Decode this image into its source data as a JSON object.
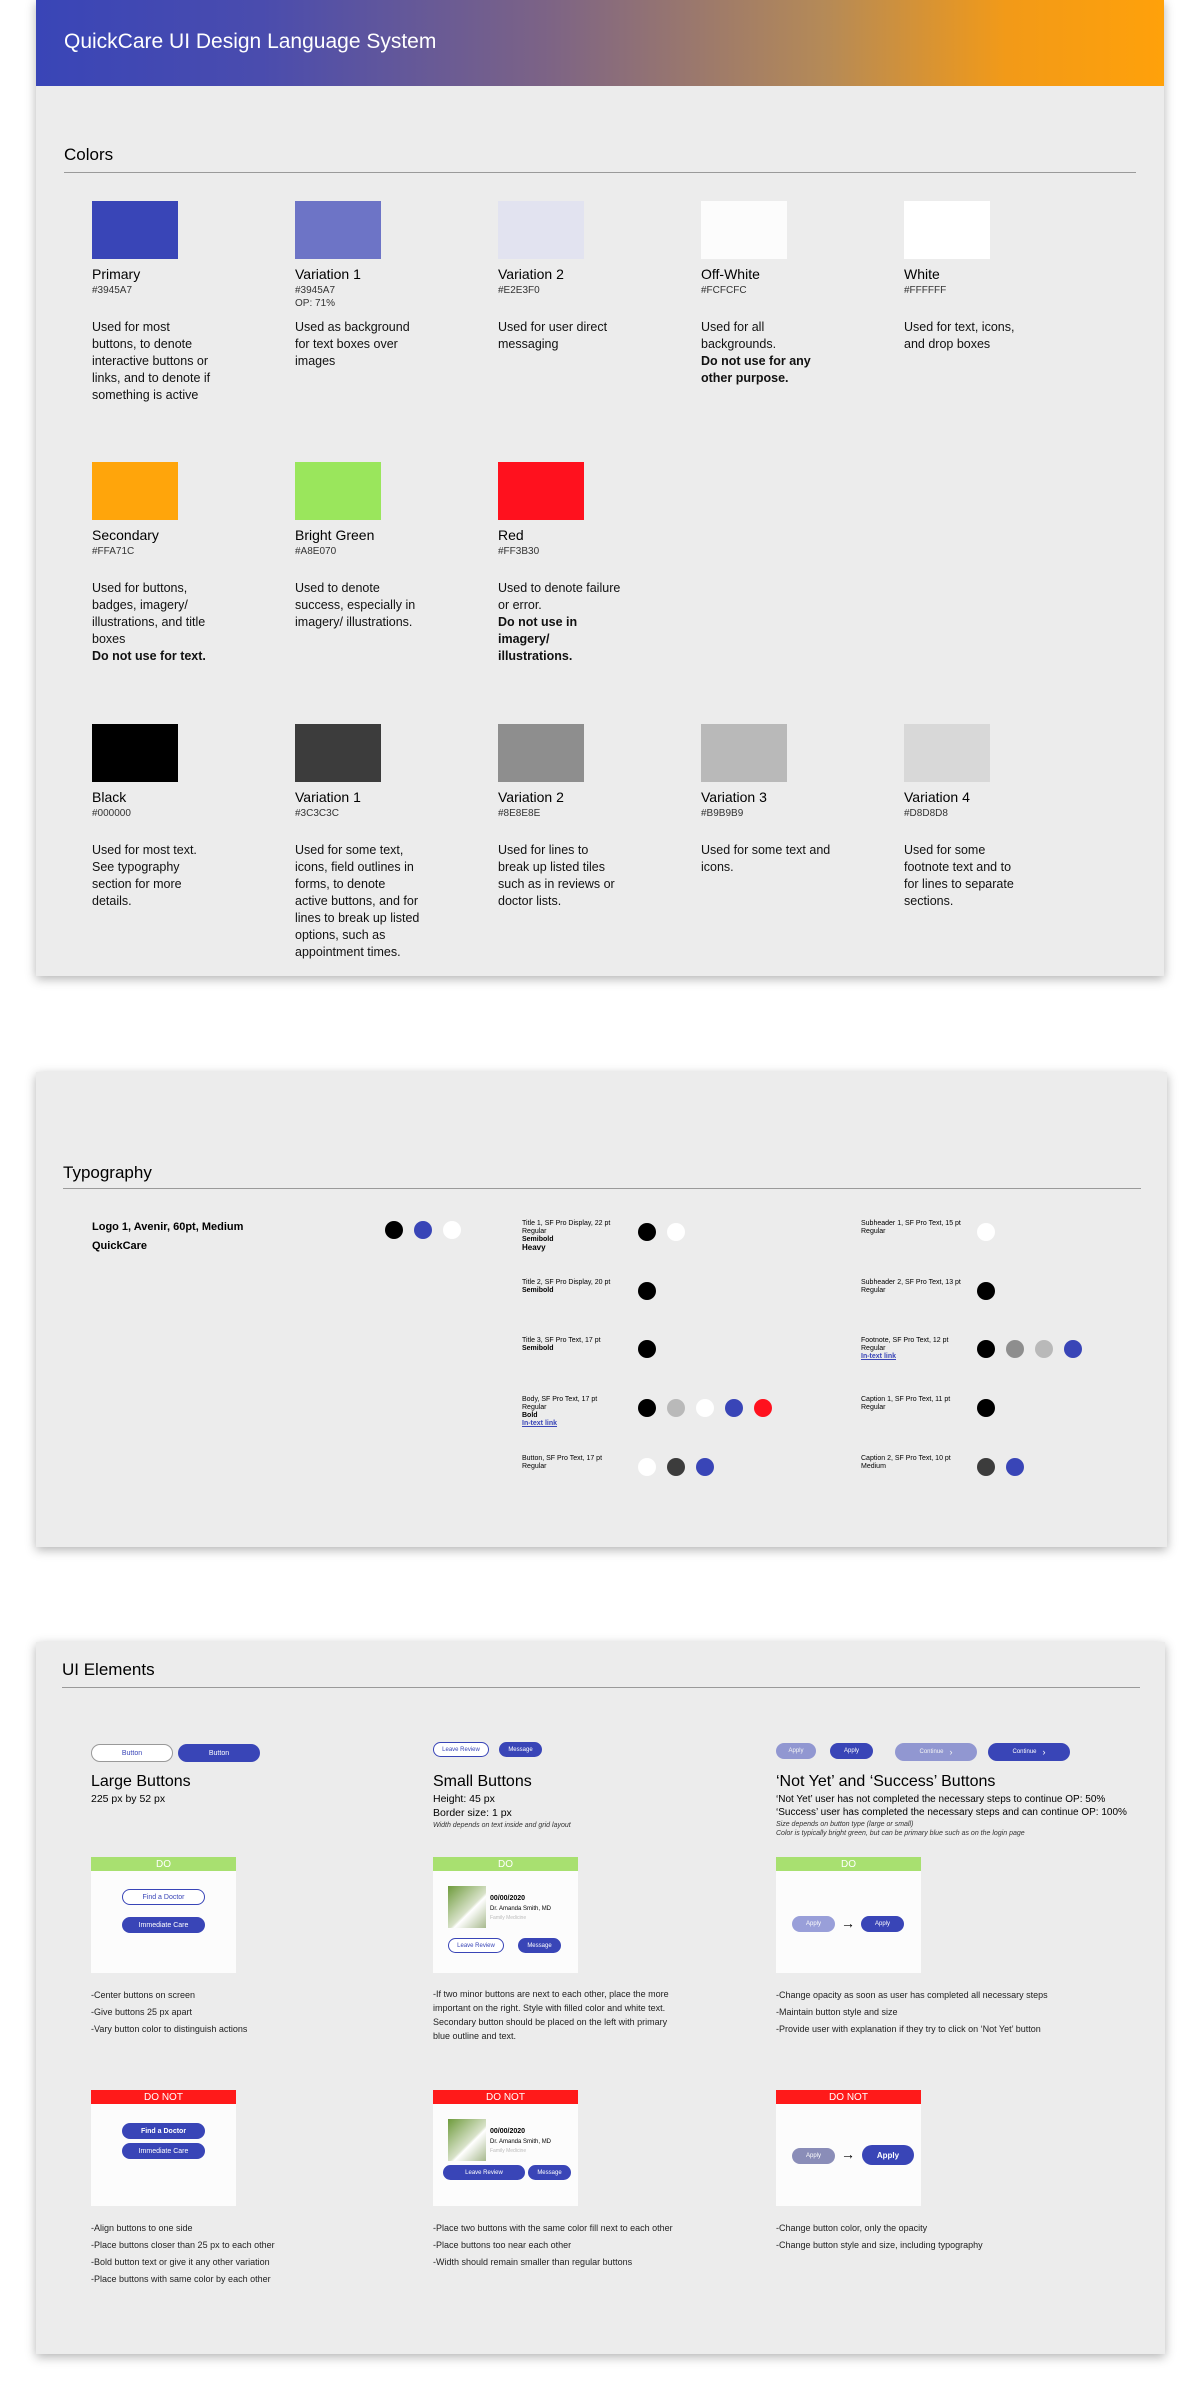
{
  "header": {
    "title": "QuickCare UI Design Language System"
  },
  "colors_section": {
    "title": "Colors",
    "row1": [
      {
        "name": "Primary",
        "hex": "#3945A7",
        "op": "",
        "desc": "Used for most buttons, to denote interactive buttons or links, and to denote if something is active",
        "note": "",
        "color": "#3945B7"
      },
      {
        "name": "Variation 1",
        "hex": "#3945A7",
        "op": "OP: 71%",
        "desc": "Used as background for text boxes over images",
        "note": "",
        "color": "#6D74C6"
      },
      {
        "name": "Variation 2",
        "hex": "#E2E3F0",
        "op": "",
        "desc": "Used for user direct messaging",
        "note": "",
        "color": "#E2E3F0"
      },
      {
        "name": "Off-White",
        "hex": "#FCFCFC",
        "op": "",
        "desc": "Used for all backgrounds.",
        "note": "Do not use for any other purpose.",
        "color": "#FCFCFC"
      },
      {
        "name": "White",
        "hex": "#FFFFFF",
        "op": "",
        "desc": "Used for text, icons, and drop boxes",
        "note": "",
        "color": "#FFFFFF"
      }
    ],
    "row2": [
      {
        "name": "Secondary",
        "hex": "#FFA71C",
        "op": "",
        "desc": "Used for buttons, badges, imagery/ illustrations, and title boxes",
        "note": "Do not use for text.",
        "color": "#FFA50B"
      },
      {
        "name": "Bright Green",
        "hex": "#A8E070",
        "op": "",
        "desc": "Used to denote success, especially in imagery/ illustrations.",
        "note": "",
        "color": "#9AE65C"
      },
      {
        "name": "Red",
        "hex": "#FF3B30",
        "op": "",
        "desc": "Used to denote failure or error.",
        "note": "Do not use in imagery/ illustrations.",
        "color": "#FF111E"
      }
    ],
    "row3": [
      {
        "name": "Black",
        "hex": "#000000",
        "op": "",
        "desc": "Used for most text. See typography section for more details.",
        "note": "",
        "color": "#000000"
      },
      {
        "name": "Variation 1",
        "hex": "#3C3C3C",
        "op": "",
        "desc": "Used for some text, icons, field outlines in forms, to denote active buttons, and for lines to break up listed options, such as appointment times.",
        "note": "",
        "color": "#3C3C3C"
      },
      {
        "name": "Variation 2",
        "hex": "#8E8E8E",
        "op": "",
        "desc": "Used for lines to break up listed tiles such as in reviews or doctor lists.",
        "note": "",
        "color": "#8E8E8E"
      },
      {
        "name": "Variation 3",
        "hex": "#B9B9B9",
        "op": "",
        "desc": "Used for some text and icons.",
        "note": "",
        "color": "#B9B9B9"
      },
      {
        "name": "Variation 4",
        "hex": "#D8D8D8",
        "op": "",
        "desc": "Used for some footnote text and to for lines to separate sections.",
        "note": "",
        "color": "#D8D8D8"
      }
    ]
  },
  "typography": {
    "title": "Typography",
    "logo_label": "Logo 1, Avenir, 60pt, Medium",
    "logo_text": "QuickCare",
    "logo_dots": [
      "#000000",
      "#3945B7",
      "#FFFFFF"
    ],
    "mid": [
      {
        "l1": "Title 1, SF Pro Display, 22 pt",
        "l2": "Regular",
        "l3": "Semibold",
        "l4": "Heavy",
        "dots": [
          "#000000",
          "#FFFFFF"
        ]
      },
      {
        "l1": "Title 2, SF Pro Display, 20 pt",
        "l2": "Semibold",
        "dots": [
          "#000000"
        ]
      },
      {
        "l1": "Title 3, SF Pro Text, 17 pt",
        "l2": "Semibold",
        "dots": [
          "#000000"
        ]
      },
      {
        "l1": "Body, SF Pro Text, 17 pt",
        "l2": "Regular",
        "l3": "Bold",
        "l4": "In-text link",
        "dots": [
          "#000000",
          "#B9B9B9",
          "#FFFFFF",
          "#3945B7",
          "#FF111E"
        ]
      },
      {
        "l1": "Button, SF Pro Text, 17 pt",
        "l2": "Regular",
        "dots": [
          "#FFFFFF",
          "#3C3C3C",
          "#3945B7"
        ]
      }
    ],
    "right": [
      {
        "l1": "Subheader 1, SF Pro Text, 15 pt",
        "l2": "Regular",
        "dots": [
          "#FFFFFF"
        ]
      },
      {
        "l1": "Subheader 2, SF Pro Text, 13 pt",
        "l2": "Regular",
        "dots": [
          "#000000"
        ]
      },
      {
        "l1": "Footnote, SF Pro Text, 12 pt",
        "l2": "Regular",
        "l3": "In-text link",
        "dots": [
          "#000000",
          "#8E8E8E",
          "#B9B9B9",
          "#3945B7"
        ]
      },
      {
        "l1": "Caption 1, SF Pro Text, 11 pt",
        "l2": "Regular",
        "dots": [
          "#000000"
        ]
      },
      {
        "l1": "Caption 2, SF Pro Text, 10 pt",
        "l2": "Medium",
        "dots": [
          "#3C3C3C",
          "#3945B7"
        ]
      }
    ]
  },
  "ui": {
    "title": "UI Elements",
    "large": {
      "b1": "Button",
      "b2": "Button",
      "head": "Large Buttons",
      "sub": "225 px by 52 px",
      "do_tag": "DO",
      "do_b1": "Find a Doctor",
      "do_b2": "Immediate Care",
      "do_bullets": [
        "-Center buttons on screen",
        "-Give buttons 25 px apart",
        "-Vary button color to distinguish actions"
      ],
      "dont_tag": "DO NOT",
      "dont_b1": "Find a Doctor",
      "dont_b2": "Immediate Care",
      "dont_bullets": [
        "-Align buttons to one side",
        "-Place buttons closer than 25 px to each other",
        "-Bold button text or give it any other variation",
        "-Place buttons with same color by each other"
      ]
    },
    "small": {
      "b1": "Leave Review",
      "b2": "Message",
      "head": "Small Buttons",
      "sub1": "Height: 45 px",
      "sub2": "Border size: 1 px",
      "note": "Width depends on text inside and grid layout",
      "do_tag": "DO",
      "date": "00/00/2020",
      "doc": "Dr. Amanda Smith, MD",
      "spec": "Family Medicine",
      "do_b1": "Leave Review",
      "do_b2": "Message",
      "do_bullets": [
        "-If two minor buttons are next to each other, place the more important on the right. Style with filled color and white text. Secondary button should be placed on the left with primary blue outline and text."
      ],
      "dont_tag": "DO NOT",
      "dont_b1": "Leave Review",
      "dont_b2": "Message",
      "dont_bullets": [
        "-Place two buttons with the same color fill next to each other",
        "-Place buttons too near each other",
        "-Width should remain smaller than regular buttons"
      ]
    },
    "state": {
      "b1": "Apply",
      "b2": "Apply",
      "b3": "Continue",
      "b4": "Continue",
      "head": "‘Not Yet’ and ‘Success’ Buttons",
      "sub1": "‘Not Yet’ user has not completed the necessary steps to continue OP: 50%",
      "sub2": "‘Success’ user has completed the necessary steps and can continue OP: 100%",
      "note1": "Size depends on button type (large or small)",
      "note2": "Color is typically bright green, but can be primary blue such as on the login page",
      "do_tag": "DO",
      "do_b1": "Apply",
      "do_b2": "Apply",
      "do_bullets": [
        "-Change opacity as soon as user has completed all necessary steps",
        "-Maintain button style and size",
        "-Provide user with explanation if they try to click on ‘Not Yet’ button"
      ],
      "dont_tag": "DO NOT",
      "dont_b1": "Apply",
      "dont_b2": "Apply",
      "dont_bullets": [
        "-Change button color, only the opacity",
        "-Change button style and size, including typography"
      ]
    }
  }
}
